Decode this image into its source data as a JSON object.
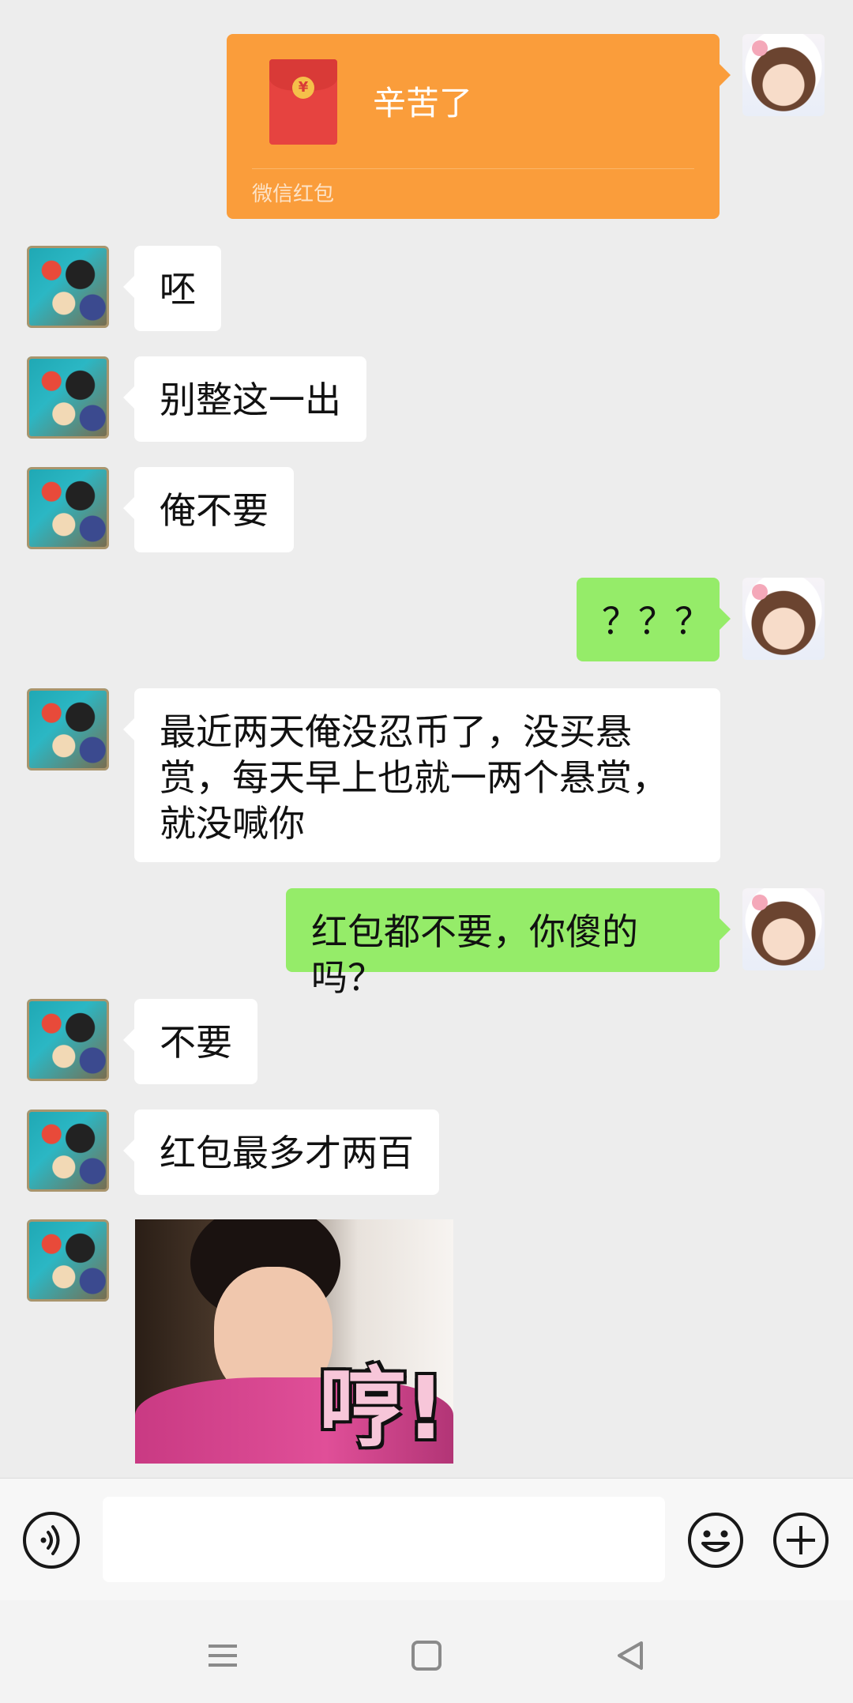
{
  "red_packet": {
    "title": "辛苦了",
    "footer": "微信红包",
    "coin_symbol": "¥",
    "color": "#fa9d3b"
  },
  "messages": [
    {
      "side": "left",
      "text": "呸"
    },
    {
      "side": "left",
      "text": "别整这一出"
    },
    {
      "side": "left",
      "text": "俺不要"
    },
    {
      "side": "right",
      "text": "？？？"
    },
    {
      "side": "left",
      "text": "最近两天俺没忍币了，没买悬赏，每天早上也就一两个悬赏，就没喊你"
    },
    {
      "side": "right",
      "text": "红包都不要，你傻的吗？"
    },
    {
      "side": "left",
      "text": "不要"
    },
    {
      "side": "left",
      "text": "红包最多才两百"
    }
  ],
  "sticker": {
    "caption": "哼!"
  },
  "input_bar": {
    "voice_icon": "voice-icon",
    "emoji_icon": "emoji-icon",
    "plus_icon": "plus-icon",
    "text_value": ""
  },
  "nav_bar": {
    "menu_icon": "menu-icon",
    "home_icon": "home-icon",
    "back_icon": "back-icon"
  },
  "colors": {
    "background": "#ededed",
    "bubble_self": "#95ec69",
    "bubble_other": "#ffffff"
  }
}
